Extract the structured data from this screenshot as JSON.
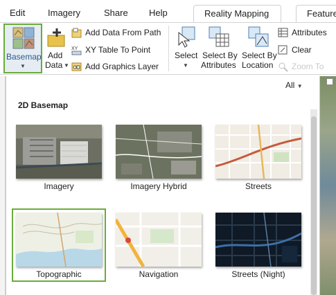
{
  "menu": {
    "edit": "Edit",
    "imagery": "Imagery",
    "share": "Share",
    "help": "Help",
    "reality_mapping": "Reality Mapping",
    "feature": "Feature"
  },
  "ribbon": {
    "basemap": "Basemap",
    "add_data_line1": "Add",
    "add_data_line2": "Data",
    "add_data_from_path": "Add Data From Path",
    "xy_table_to_point": "XY Table To Point",
    "add_graphics_layer": "Add Graphics Layer",
    "select": "Select",
    "select_by_attributes_line1": "Select By",
    "select_by_attributes_line2": "Attributes",
    "select_by_location_line1": "Select By",
    "select_by_location_line2": "Location",
    "attributes": "Attributes",
    "clear": "Clear",
    "zoom_to": "Zoom To"
  },
  "gallery": {
    "filter": "All",
    "section_title": "2D Basemap",
    "items": [
      {
        "label": "Imagery",
        "icon": "imagery-thumbnail"
      },
      {
        "label": "Imagery Hybrid",
        "icon": "imagery-hybrid-thumbnail"
      },
      {
        "label": "Streets",
        "icon": "streets-thumbnail"
      },
      {
        "label": "Topographic",
        "icon": "topographic-thumbnail",
        "selected": true
      },
      {
        "label": "Navigation",
        "icon": "navigation-thumbnail"
      },
      {
        "label": "Streets (Night)",
        "icon": "streets-night-thumbnail"
      }
    ]
  },
  "colors": {
    "selection_green": "#6aab3a",
    "ribbon_border": "#d4d4d4"
  }
}
